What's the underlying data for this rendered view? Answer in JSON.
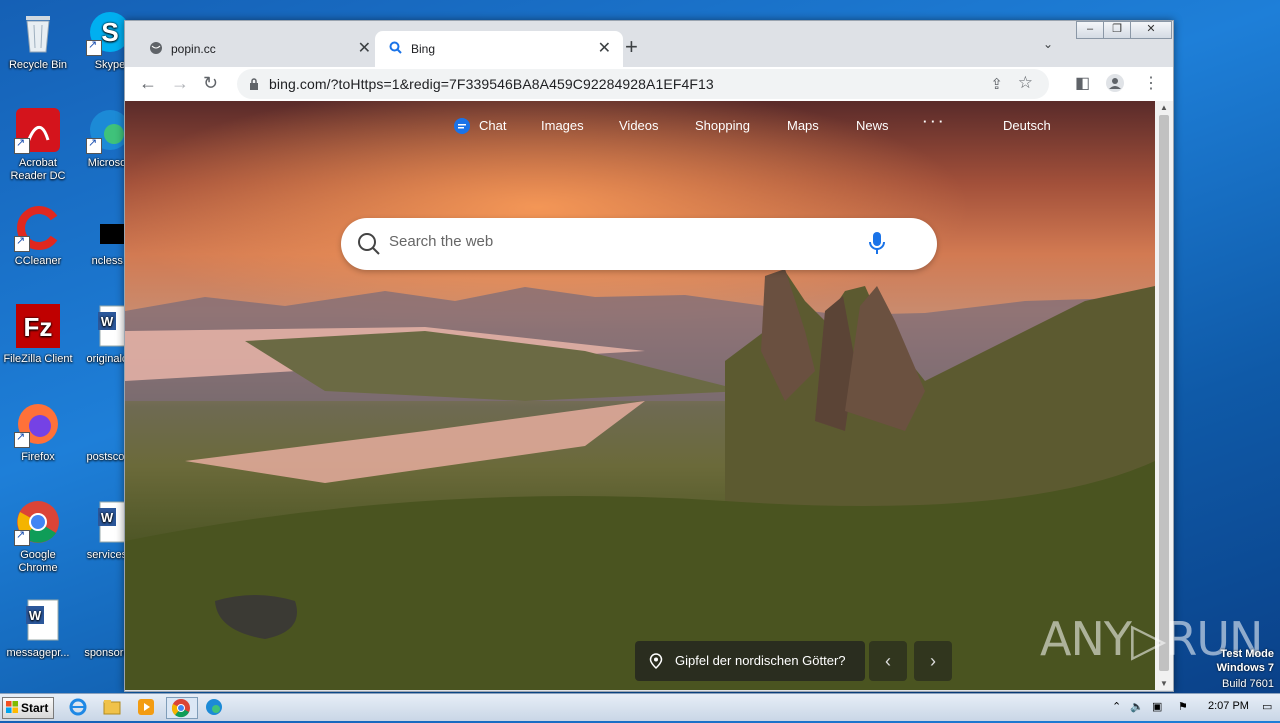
{
  "desktop": {
    "icons": [
      {
        "label": "Recycle Bin"
      },
      {
        "label": "Skype"
      },
      {
        "label": "Acrobat Reader DC"
      },
      {
        "label": "Microsoft"
      },
      {
        "label": "CCleaner"
      },
      {
        "label": "ncless.j"
      },
      {
        "label": "FileZilla Client"
      },
      {
        "label": "originalce"
      },
      {
        "label": "Firefox"
      },
      {
        "label": "postsconf"
      },
      {
        "label": "Google Chrome"
      },
      {
        "label": "servicesp"
      },
      {
        "label": "messagepr..."
      },
      {
        "label": "sponsored"
      }
    ]
  },
  "browser": {
    "tabs": [
      {
        "title": "popin.cc",
        "active": false
      },
      {
        "title": "Bing",
        "active": true
      }
    ],
    "new_tab": "+",
    "address": "bing.com/?toHttps=1&redig=7F339546BA8A459C92284928A1EF4F13"
  },
  "bing": {
    "nav": {
      "chat": "Chat",
      "images": "Images",
      "videos": "Videos",
      "shopping": "Shopping",
      "maps": "Maps",
      "news": "News",
      "more": "· · ·",
      "language": "Deutsch"
    },
    "search_placeholder": "Search the web",
    "caption": "Gipfel der nordischen Götter?",
    "prev": "‹",
    "next": "›"
  },
  "taskbar": {
    "start_label": "Start",
    "clock": "2:07 PM"
  },
  "watermark": {
    "line1": "Test Mode",
    "line2": "Windows 7",
    "line3": "Build 7601",
    "brand": "ANY▷RUN"
  },
  "colors": {
    "bing_accent": "#1a73e8",
    "tab_bg": "#dee1e6"
  }
}
